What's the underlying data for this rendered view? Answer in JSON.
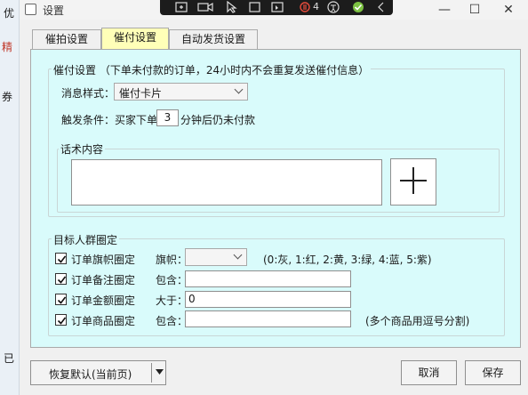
{
  "background_app": {
    "chars": [
      "优",
      "精",
      "券",
      "已"
    ]
  },
  "window": {
    "title": "设置",
    "minimize": "—",
    "maximize": "☐",
    "close": "✕"
  },
  "toolbar": {
    "badge_count": "4"
  },
  "tabs": [
    {
      "label": "催拍设置",
      "active": false
    },
    {
      "label": "催付设置",
      "active": true
    },
    {
      "label": "自动发货设置",
      "active": false
    }
  ],
  "payment_group": {
    "legend": "催付设置 （下单未付款的订单，24小时内不会重复发送催付信息）",
    "message_style_label": "消息样式：",
    "message_style_value": "催付卡片",
    "trigger_prefix": "触发条件：买家下单",
    "trigger_minutes": "3",
    "trigger_suffix": "分钟后仍未付款",
    "script_legend": "话术内容",
    "script_value": ""
  },
  "audience_group": {
    "legend": "目标人群圈定",
    "rows": [
      {
        "label": "订单旗帜圈定",
        "checked": true,
        "field_label": "旗帜：",
        "value": "",
        "hint": "(0:灰, 1:红, 2:黄, 3:绿, 4:蓝, 5:紫)"
      },
      {
        "label": "订单备注圈定",
        "checked": true,
        "field_label": "包含：",
        "value": "",
        "hint": ""
      },
      {
        "label": "订单金额圈定",
        "checked": true,
        "field_label": "大于：",
        "value": "0",
        "hint": ""
      },
      {
        "label": "订单商品圈定",
        "checked": true,
        "field_label": "包含：",
        "value": "",
        "hint": "(多个商品用逗号分割)"
      }
    ]
  },
  "footer": {
    "default_button": "恢复默认(当前页)",
    "cancel": "取消",
    "save": "保存"
  }
}
